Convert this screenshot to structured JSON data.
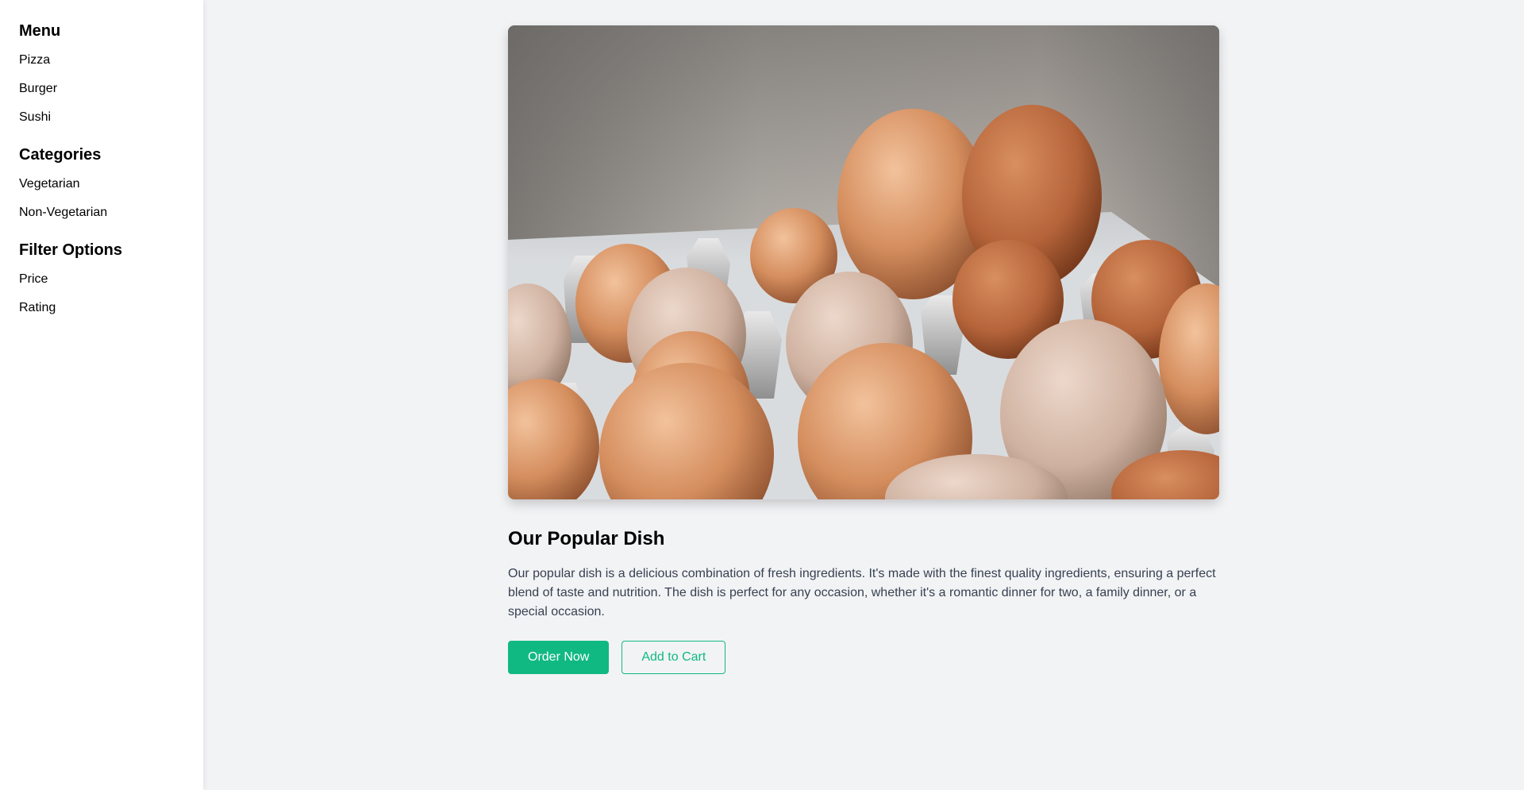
{
  "sidebar": {
    "sections": [
      {
        "title": "Menu",
        "items": [
          "Pizza",
          "Burger",
          "Sushi"
        ]
      },
      {
        "title": "Categories",
        "items": [
          "Vegetarian",
          "Non-Vegetarian"
        ]
      },
      {
        "title": "Filter Options",
        "items": [
          "Price",
          "Rating"
        ]
      }
    ]
  },
  "main": {
    "image_subject": "brown eggs in carton",
    "title": "Our Popular Dish",
    "description": "Our popular dish is a delicious combination of fresh ingredients. It's made with the finest quality ingredients, ensuring a perfect blend of taste and nutrition. The dish is perfect for any occasion, whether it's a romantic dinner for two, a family dinner, or a special occasion.",
    "order_button": "Order Now",
    "cart_button": "Add to Cart"
  },
  "colors": {
    "accent": "#10b981",
    "background": "#f2f3f5",
    "sidebar": "#ffffff",
    "body_text": "#374151"
  }
}
